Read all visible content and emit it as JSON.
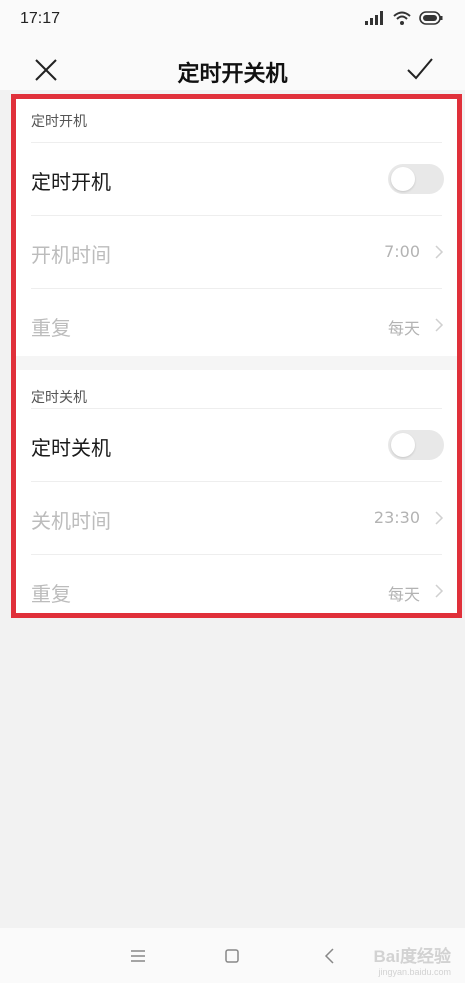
{
  "status_bar": {
    "time": "17:17",
    "icons": [
      "signal-icon",
      "wifi-icon",
      "battery-icon"
    ]
  },
  "header": {
    "title": "定时开关机",
    "close_icon": "close-icon",
    "confirm_icon": "check-icon"
  },
  "power_on": {
    "section_label": "定时开机",
    "toggle_label": "定时开机",
    "toggle_on": false,
    "time_label": "开机时间",
    "time_value": "7:00",
    "repeat_label": "重复",
    "repeat_value": "每天"
  },
  "power_off": {
    "section_label": "定时关机",
    "toggle_label": "定时关机",
    "toggle_on": false,
    "time_label": "关机时间",
    "time_value": "23:30",
    "repeat_label": "重复",
    "repeat_value": "每天"
  },
  "nav_bar": {
    "icons": [
      "menu-icon",
      "home-icon",
      "back-icon"
    ]
  },
  "watermark": {
    "brand": "Bai度经验",
    "site": "jingyan.baidu.com"
  },
  "colors": {
    "highlight": "#e0303a",
    "disabled_text": "#bcbcbc",
    "value_text": "#b3b3b3"
  }
}
